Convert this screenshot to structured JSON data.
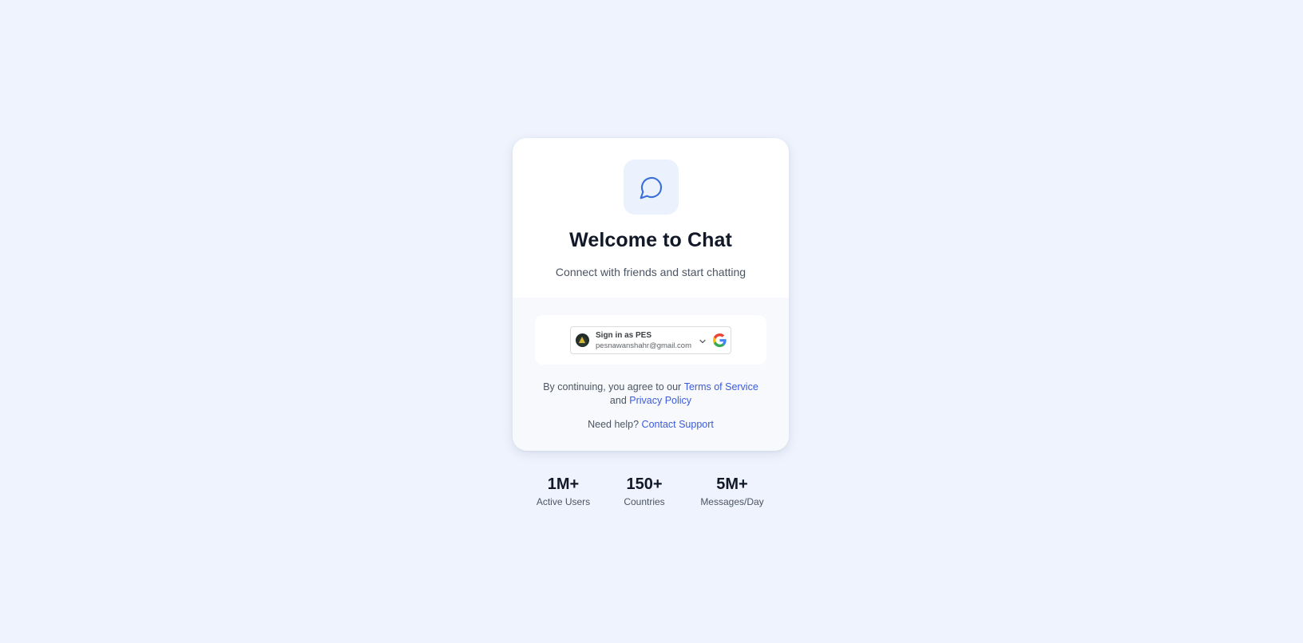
{
  "app": {
    "title": "Welcome to Chat",
    "subtitle": "Connect with friends and start chatting",
    "logo_icon": "chat-bubble-icon",
    "accent_color": "#3b5bdb",
    "logo_bg_color": "#ecf2fd"
  },
  "signin": {
    "label": "Sign in as PES",
    "email": "pesnawanshahr@gmail.com",
    "provider_icon": "google-icon",
    "dropdown_icon": "chevron-down-icon"
  },
  "legal": {
    "prefix": "By continuing, you agree to our",
    "terms_label": "Terms of Service",
    "and": "and",
    "privacy_label": "Privacy Policy"
  },
  "help": {
    "prefix": "Need help?",
    "contact_label": "Contact Support"
  },
  "stats": [
    {
      "value": "1M+",
      "label": "Active Users"
    },
    {
      "value": "150+",
      "label": "Countries"
    },
    {
      "value": "5M+",
      "label": "Messages/Day"
    }
  ]
}
